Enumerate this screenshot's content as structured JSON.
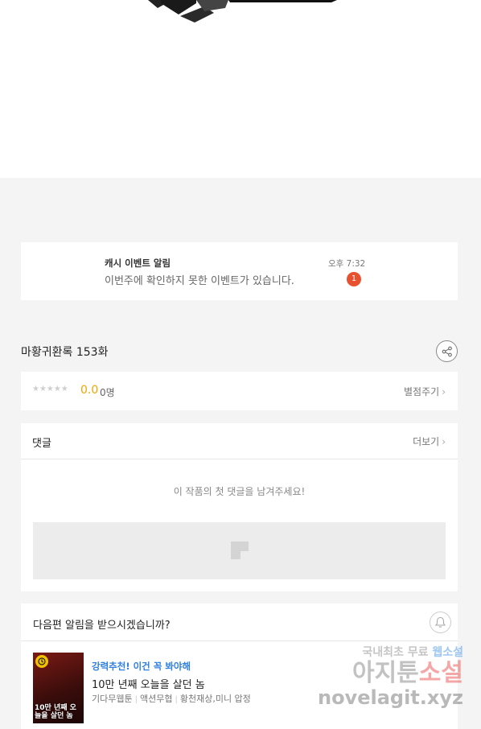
{
  "notification": {
    "title": "캐시 이벤트 알림",
    "message": "이번주에 확인하지 못한 이벤트가 있습니다.",
    "time": "오후 7:32",
    "badge_count": "1"
  },
  "episode": {
    "title": "마황귀환록 153화",
    "share_icon": "share-icon"
  },
  "rating": {
    "stars": "★★★★★",
    "score": "0.0",
    "count": "0명",
    "rate_link": "별점주기",
    "chevron": "›"
  },
  "comments": {
    "title": "댓글",
    "more_link": "더보기",
    "chevron": "›",
    "empty_message": "이 작품의 첫 댓글을 남겨주세요!"
  },
  "next_episode": {
    "title": "다음편 알림을 받으시겠습니까?",
    "bell_icon": "bell-icon"
  },
  "recommendation": {
    "label": "강력추천! 이건 꼭 봐야해",
    "title": "10만 년째 오늘을 살던 놈",
    "thumb_text": "10만 년째 오늘을 살던 놈",
    "tags": [
      "기다무웹툰",
      "액션무협",
      "황천재상,미니 압정"
    ]
  },
  "watermark": {
    "line1_a": "국내최초 무료 ",
    "line1_b": "웹소설",
    "line2_a": "아지툰",
    "line2_b": "소설",
    "line3": "novelagit.xyz"
  },
  "colors": {
    "accent_blue": "#2f7fe0",
    "badge_red": "#e8512f",
    "score_orange": "#f0a400"
  }
}
